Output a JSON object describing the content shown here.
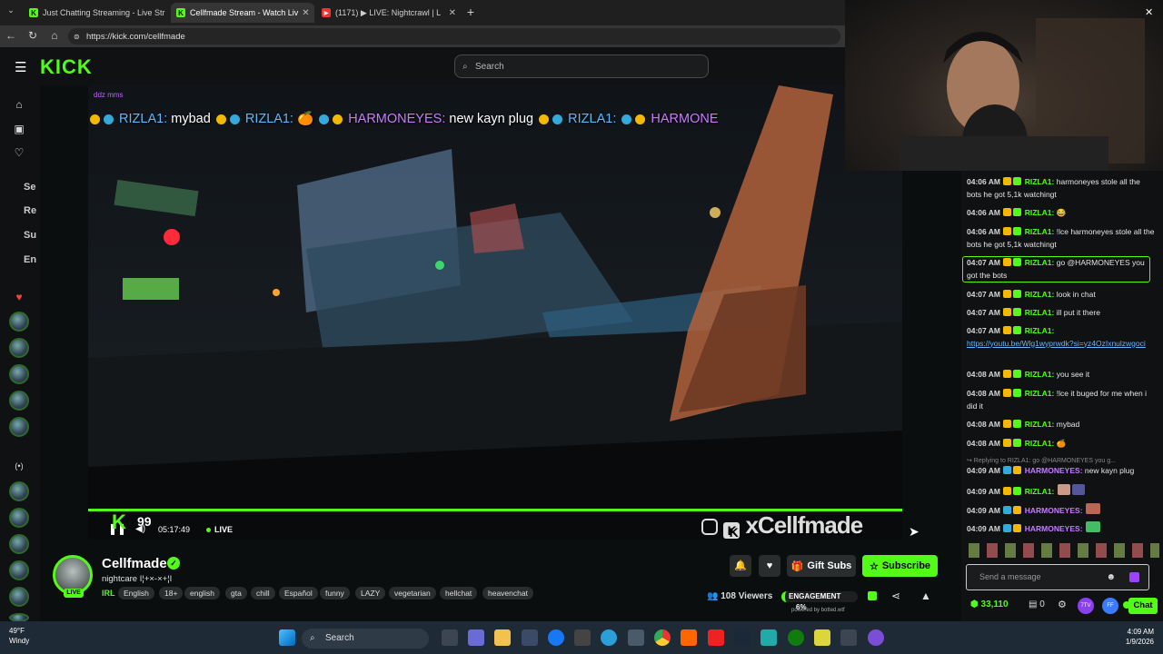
{
  "browser": {
    "tabs": [
      {
        "title": "Just Chatting Streaming - Live Str",
        "active": false
      },
      {
        "title": "Cellfmade Stream - Watch Liv",
        "active": true
      },
      {
        "title": "(1171) ▶ LIVE: Nightcrawl | L",
        "active": false
      }
    ],
    "url": "https://kick.com/cellfmade"
  },
  "kick": {
    "logo": "KICK",
    "search_placeholder": "Search",
    "nav_items": [
      "Se",
      "Re",
      "Su",
      "En"
    ]
  },
  "video": {
    "chat_overlay": [
      {
        "name": "RIZLA1:",
        "text": "mybad"
      },
      {
        "name": "RIZLA1:",
        "text": "🍊"
      },
      {
        "name": "HARMONEYES:",
        "text": "new kayn plug"
      },
      {
        "name": "RIZLA1:",
        "text": ""
      },
      {
        "name": "HARMONE",
        "text": ""
      }
    ],
    "overlay_top_small": "ddz mms",
    "score_overlay": "99",
    "uptime": "05:17:49",
    "live_label": "LIVE",
    "watermark": "xCellfmade"
  },
  "stream": {
    "streamer": "Cellfmade",
    "live_pill": "LIVE",
    "title": "nightcare I¦+×-×+¦I",
    "category": "IRL",
    "tags": [
      "English",
      "18+",
      "english",
      "gta",
      "chill",
      "Español",
      "funny",
      "LAZY",
      "vegetarian",
      "hellchat",
      "heavenchat"
    ],
    "gift_subs": "Gift Subs",
    "subscribe": "Subscribe",
    "viewers": "108 Viewers",
    "engagement_label": "ENGAGEMENT",
    "engagement_value": "6%",
    "powered_by": "powered by botted.wtf"
  },
  "chat": {
    "messages": [
      {
        "ts": "04:06 AM",
        "name": "RIZLA1:",
        "text": "harmoneyes stole all the bots he got 5,1k watchingt",
        "color": "#53fc18"
      },
      {
        "ts": "04:06 AM",
        "name": "RIZLA1:",
        "text": "😂",
        "color": "#53fc18"
      },
      {
        "ts": "04:06 AM",
        "name": "RIZLA1:",
        "text": "!lce harmoneyes stole all the bots he got 5,1k watchingt",
        "color": "#53fc18"
      },
      {
        "ts": "04:07 AM",
        "name": "RIZLA1:",
        "text": "go @HARMONEYES you got the bots",
        "color": "#53fc18"
      },
      {
        "ts": "04:07 AM",
        "name": "RIZLA1:",
        "text": "look in chat",
        "color": "#53fc18"
      },
      {
        "ts": "04:07 AM",
        "name": "RIZLA1:",
        "text": "ill put it there",
        "color": "#53fc18"
      },
      {
        "ts": "04:07 AM",
        "name": "RIZLA1:",
        "text": "https://youtu.be/Wlg1wyprwdk?si=yz4OzIxnulzwgoci",
        "color": "#53fc18"
      },
      {
        "ts": "04:08 AM",
        "name": "RIZLA1:",
        "text": "you see it",
        "color": "#53fc18"
      },
      {
        "ts": "04:08 AM",
        "name": "RIZLA1:",
        "text": "!lce it buged for me when i did it",
        "color": "#53fc18"
      },
      {
        "ts": "04:08 AM",
        "name": "RIZLA1:",
        "text": "mybad",
        "color": "#53fc18"
      },
      {
        "ts": "04:08 AM",
        "name": "RIZLA1:",
        "text": "🍊",
        "color": "#53fc18"
      },
      {
        "ts": "",
        "name": "",
        "text": "↪ Replying to RIZLA1: go @HARMONEYES you g...",
        "color": "#888"
      },
      {
        "ts": "04:09 AM",
        "name": "HARMONEYES:",
        "text": "new kayn plug",
        "color": "#c67bff"
      },
      {
        "ts": "04:09 AM",
        "name": "RIZLA1:",
        "text": "",
        "color": "#53fc18"
      },
      {
        "ts": "04:09 AM",
        "name": "HARMONEYES:",
        "text": "",
        "color": "#c67bff"
      },
      {
        "ts": "04:09 AM",
        "name": "HARMONEYES:",
        "text": "",
        "color": "#c67bff"
      }
    ],
    "input_placeholder": "Send a message",
    "points": "33,110",
    "count": "0",
    "chat_button": "Chat"
  },
  "taskbar": {
    "weather_temp": "49°F",
    "weather_desc": "Windy",
    "search": "Search",
    "time": "4:09 AM",
    "date": "1/9/2026"
  },
  "colors": {
    "accent": "#53fc18",
    "bg": "#0b0e0f"
  }
}
